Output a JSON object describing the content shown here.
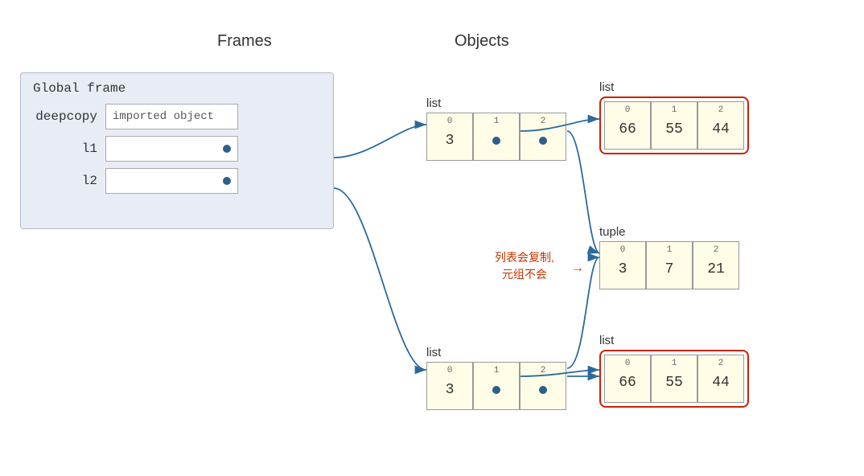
{
  "headers": {
    "frames": "Frames",
    "objects": "Objects"
  },
  "global_frame": {
    "title": "Global frame",
    "rows": [
      {
        "label": "deepcopy",
        "value": "imported object",
        "has_dot": false
      },
      {
        "label": "l1",
        "value": "",
        "has_dot": true
      },
      {
        "label": "l2",
        "value": "",
        "has_dot": true
      }
    ]
  },
  "arrays": {
    "l1_list": {
      "label": "list",
      "cells": [
        {
          "index": "0",
          "value": "3",
          "type": "number"
        },
        {
          "index": "1",
          "value": "",
          "type": "dot"
        },
        {
          "index": "2",
          "value": "",
          "type": "dot"
        }
      ]
    },
    "inner_list_top": {
      "label": "list",
      "cells": [
        {
          "index": "0",
          "value": "66",
          "type": "number"
        },
        {
          "index": "1",
          "value": "55",
          "type": "number"
        },
        {
          "index": "2",
          "value": "44",
          "type": "number"
        }
      ],
      "highlighted": true
    },
    "tuple": {
      "label": "tuple",
      "cells": [
        {
          "index": "0",
          "value": "3",
          "type": "number"
        },
        {
          "index": "1",
          "value": "7",
          "type": "number"
        },
        {
          "index": "2",
          "value": "21",
          "type": "number"
        }
      ]
    },
    "l2_list": {
      "label": "list",
      "cells": [
        {
          "index": "0",
          "value": "3",
          "type": "number"
        },
        {
          "index": "1",
          "value": "",
          "type": "dot"
        },
        {
          "index": "2",
          "value": "",
          "type": "dot"
        }
      ]
    },
    "inner_list_bottom": {
      "label": "list",
      "cells": [
        {
          "index": "0",
          "value": "66",
          "type": "number"
        },
        {
          "index": "1",
          "value": "55",
          "type": "number"
        },
        {
          "index": "2",
          "value": "44",
          "type": "number"
        }
      ],
      "highlighted": true
    }
  },
  "annotation": {
    "text": "列表会复制,\n元组不会"
  },
  "colors": {
    "arrow": "#2c6a9a",
    "highlight_border": "#cc2200",
    "annotation": "#cc3300",
    "frame_bg": "#e8edf5",
    "cell_bg": "#fffde7"
  }
}
